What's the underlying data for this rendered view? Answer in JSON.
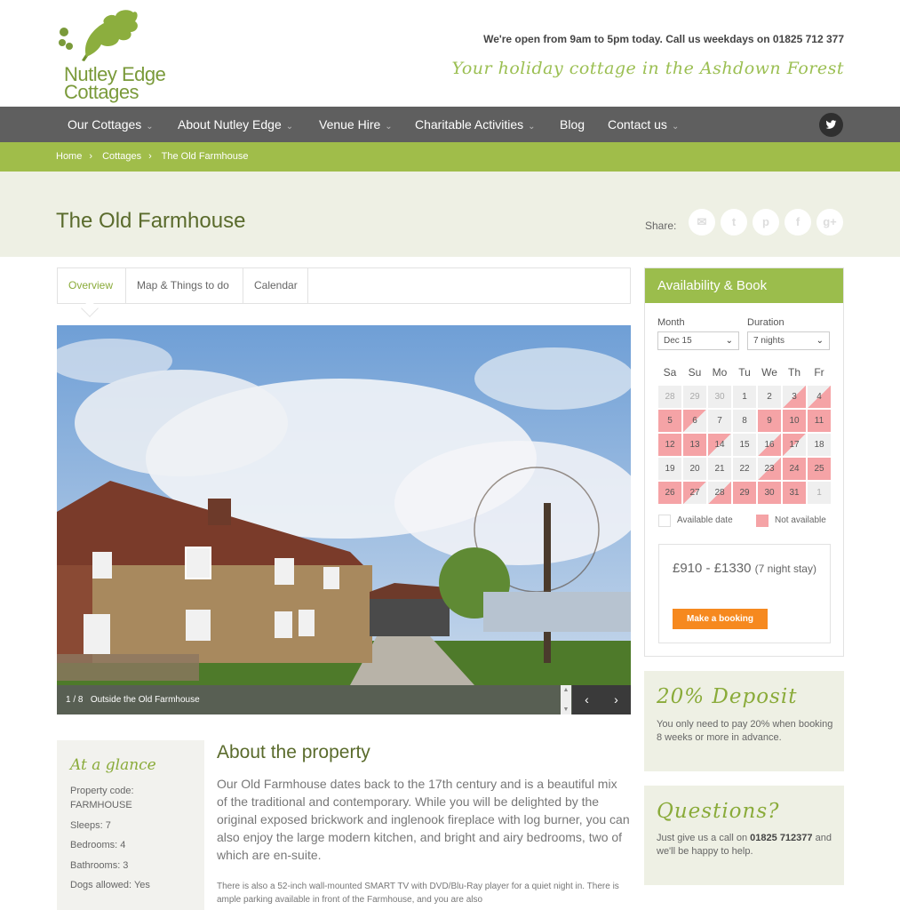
{
  "brand": {
    "line1": "Nutley Edge",
    "line2": "Cottages"
  },
  "header": {
    "open_hours": "We're open from 9am to 5pm today. Call us weekdays on 01825 712 377",
    "tagline": "Your holiday cottage in the Ashdown Forest"
  },
  "nav": {
    "items": [
      {
        "label": "Our Cottages",
        "chevron": "⌄"
      },
      {
        "label": "About Nutley Edge",
        "chevron": "⌄"
      },
      {
        "label": "Venue Hire",
        "chevron": "⌄"
      },
      {
        "label": "Charitable Activities",
        "chevron": "⌄"
      },
      {
        "label": "Blog"
      },
      {
        "label": "Contact us",
        "chevron": "⌄"
      }
    ],
    "twitter_icon": "twitter-icon"
  },
  "breadcrumb": {
    "items": [
      "Home",
      "Cottages",
      "The Old Farmhouse"
    ],
    "separator": "›"
  },
  "page": {
    "title": "The Old Farmhouse",
    "share_label": "Share:"
  },
  "share_icons": [
    "email-icon",
    "twitter-icon",
    "pinterest-icon",
    "facebook-icon",
    "google-plus-icon"
  ],
  "tabs": [
    "Overview",
    "Map & Things to do",
    "Calendar"
  ],
  "gallery": {
    "counter": "1 / 8",
    "caption": "Outside the Old Farmhouse",
    "prev": "‹",
    "next": "›"
  },
  "glance": {
    "title": "At a glance",
    "code_label": "Property code:",
    "code_value": "FARMHOUSE",
    "sleeps": "Sleeps: 7",
    "bedrooms": "Bedrooms: 4",
    "bathrooms": "Bathrooms: 3",
    "dogs": "Dogs allowed: Yes"
  },
  "about": {
    "title": "About the property",
    "p1": "Our Old Farmhouse dates back to the 17th century and is a beautiful mix of the traditional and contemporary. While you will be delighted by the original exposed brickwork and inglenook fireplace with log burner, you can also enjoy the large modern kitchen, and bright and airy bedrooms, two of which are en-suite.",
    "p2": "There is also a 52-inch wall-mounted SMART TV with DVD/Blu-Ray player for a quiet night in. There is ample parking available in front of the Farmhouse, and you are also"
  },
  "booking": {
    "title": "Availability & Book",
    "month_label": "Month",
    "month_value": "Dec 15",
    "duration_label": "Duration",
    "duration_value": "7 nights",
    "weekdays": [
      "Sa",
      "Su",
      "Mo",
      "Tu",
      "We",
      "Th",
      "Fr"
    ],
    "legend_available": "Available date",
    "legend_unavailable": "Not available",
    "price": "£910 - £1330",
    "price_note": "(7 night stay)",
    "button": "Make a booking",
    "colors": {
      "available": "#efefef",
      "unavailable": "#f5a3a6",
      "button": "#f6891f"
    }
  },
  "calendar_rows": [
    [
      [
        "28",
        "past"
      ],
      [
        "29",
        "past"
      ],
      [
        "30",
        "past"
      ],
      [
        "1",
        "avail"
      ],
      [
        "2",
        "avail"
      ],
      [
        "3",
        "sd"
      ],
      [
        "4",
        "sd"
      ]
    ],
    [
      [
        "5",
        "na"
      ],
      [
        "6",
        "ed"
      ],
      [
        "7",
        "avail"
      ],
      [
        "8",
        "avail"
      ],
      [
        "9",
        "na"
      ],
      [
        "10",
        "na"
      ],
      [
        "11",
        "na"
      ]
    ],
    [
      [
        "12",
        "na"
      ],
      [
        "13",
        "na"
      ],
      [
        "14",
        "ed"
      ],
      [
        "15",
        "avail"
      ],
      [
        "16",
        "sd"
      ],
      [
        "17",
        "ed"
      ],
      [
        "18",
        "avail"
      ]
    ],
    [
      [
        "19",
        "avail"
      ],
      [
        "20",
        "avail"
      ],
      [
        "21",
        "avail"
      ],
      [
        "22",
        "avail"
      ],
      [
        "23",
        "sd"
      ],
      [
        "24",
        "na"
      ],
      [
        "25",
        "na"
      ]
    ],
    [
      [
        "26",
        "na"
      ],
      [
        "27",
        "ed"
      ],
      [
        "28",
        "sd"
      ],
      [
        "29",
        "na"
      ],
      [
        "30",
        "na"
      ],
      [
        "31",
        "na"
      ],
      [
        "1",
        "past"
      ]
    ]
  ],
  "deposit": {
    "title": "20% Deposit",
    "text": "You only need to pay 20% when booking 8 weeks or more in advance."
  },
  "questions": {
    "title": "Questions?",
    "text_before": "Just give us a call on ",
    "phone": "01825 712377",
    "text_after": " and we'll be happy to help."
  }
}
